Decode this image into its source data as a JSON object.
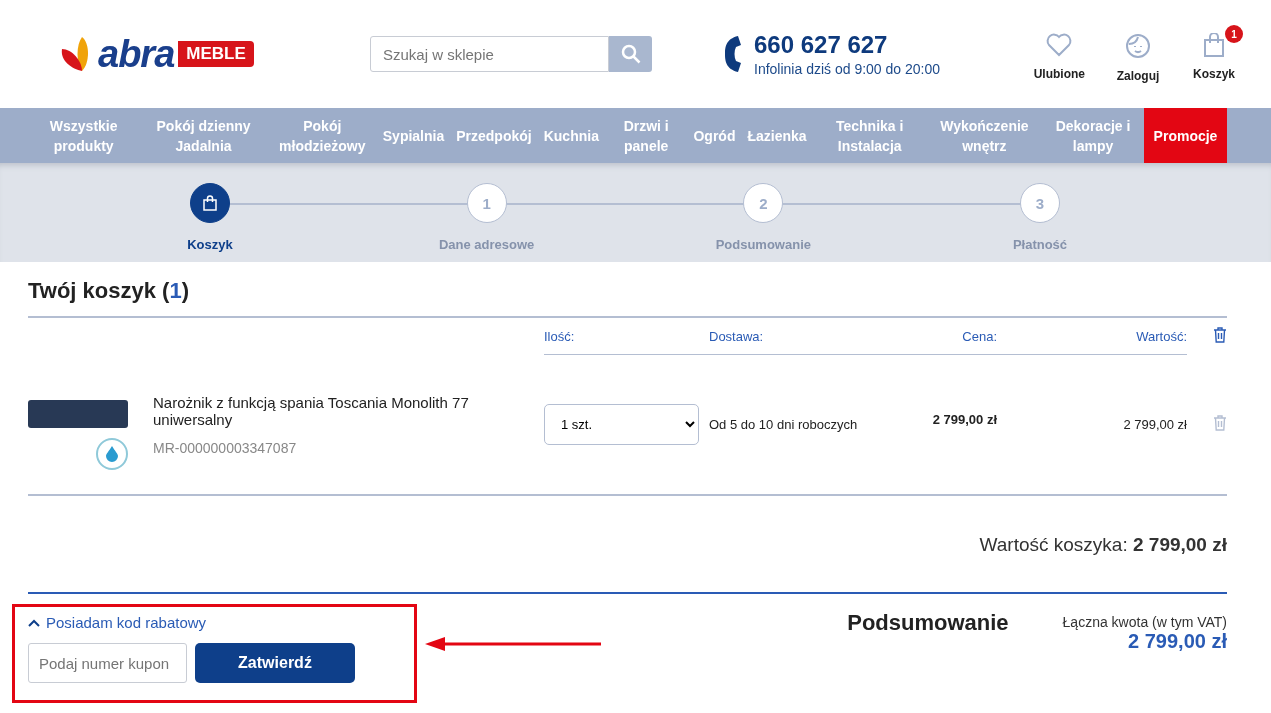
{
  "logo": {
    "word": "abra",
    "badge": "MEBLE"
  },
  "search": {
    "placeholder": "Szukaj w sklepie"
  },
  "hotline": {
    "phone": "660 627 627",
    "hours": "Infolinia dziś od 9:00 do 20:00"
  },
  "header_actions": [
    {
      "kind": "heart",
      "label": "Ulubione"
    },
    {
      "kind": "user",
      "label": "Zaloguj"
    },
    {
      "kind": "bag",
      "label": "Koszyk",
      "badge": "1"
    }
  ],
  "nav": [
    {
      "label": "Wszystkie produkty",
      "promo": false
    },
    {
      "label": "Pokój dzienny Jadalnia",
      "promo": false
    },
    {
      "label": "Pokój młodzieżowy",
      "promo": false
    },
    {
      "label": "Sypialnia",
      "promo": false
    },
    {
      "label": "Przedpokój",
      "promo": false
    },
    {
      "label": "Kuchnia",
      "promo": false
    },
    {
      "label": "Drzwi i panele",
      "promo": false
    },
    {
      "label": "Ogród",
      "promo": false
    },
    {
      "label": "Łazienka",
      "promo": false
    },
    {
      "label": "Technika i Instalacja",
      "promo": false
    },
    {
      "label": "Wykończenie wnętrz",
      "promo": false
    },
    {
      "label": "Dekoracje i lampy",
      "promo": false
    },
    {
      "label": "Promocje",
      "promo": true
    }
  ],
  "steps": [
    {
      "kind": "icon",
      "label": "Koszyk",
      "selected": true
    },
    {
      "kind": "number",
      "number": "1",
      "label": "Dane adresowe",
      "selected": false
    },
    {
      "kind": "number",
      "number": "2",
      "label": "Podsumowanie",
      "selected": false
    },
    {
      "kind": "number",
      "number": "3",
      "label": "Płatność",
      "selected": false
    }
  ],
  "cart": {
    "title": "Twój koszyk",
    "count_open": "(",
    "count": "1",
    "count_close": ")",
    "columns": [
      "Ilość:",
      "Dostawa:",
      "Cena:",
      "Wartość:"
    ],
    "items": [
      {
        "name": "Narożnik z funkcją spania Toscania Monolith 77 uniwersalny",
        "sku": "MR-000000003347087",
        "quantity": "1 szt.",
        "delivery": "Od 5 do 10 dni roboczych",
        "price": "2 799,00 zł",
        "total": "2 799,00 zł"
      }
    ],
    "total_label": "Wartość koszyka:",
    "total": "2 799,00 zł"
  },
  "coupon": {
    "toggle": "Posiadam kod rabatowy",
    "expanded": true,
    "placeholder": "Podaj numer kupon",
    "button": "Zatwierdź"
  },
  "summary": {
    "title": "Podsumowanie",
    "label": "Łączna kwota (w tym VAT)",
    "amount": "2 799,00 zł"
  }
}
